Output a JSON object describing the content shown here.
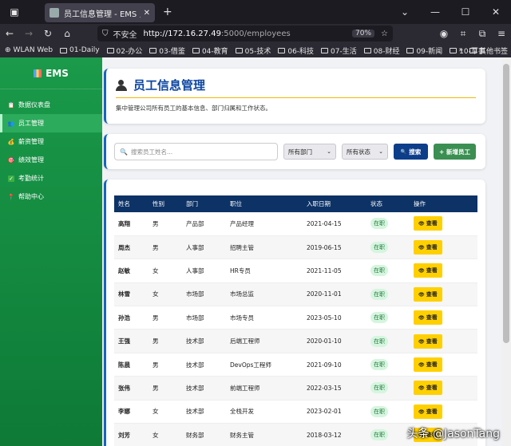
{
  "browser": {
    "tab_title": "员工信息管理 - EMS 员工管理",
    "url_insecure": "不安全",
    "url_host": "http://172.16.27.49",
    "url_path": ":5000/employees",
    "zoom": "70%",
    "bookmarks": [
      "WLAN Web",
      "01-Daily",
      "02-办公",
      "03-借鉴",
      "04-教育",
      "05-技术",
      "06-科技",
      "07-生活",
      "08-财经",
      "09-新闻",
      "10-军事"
    ],
    "bookmarks_other": "其他书签"
  },
  "sidebar": {
    "brand": "EMS",
    "items": [
      {
        "label": "数据仪表盘",
        "icon": "clipboard-icon"
      },
      {
        "label": "员工管理",
        "icon": "people-icon"
      },
      {
        "label": "薪资管理",
        "icon": "money-bag-icon"
      },
      {
        "label": "绩效管理",
        "icon": "target-icon"
      },
      {
        "label": "考勤统计",
        "icon": "check-icon"
      },
      {
        "label": "帮助中心",
        "icon": "pin-icon"
      }
    ]
  },
  "header": {
    "title": "员工信息管理",
    "description": "集中管理公司所有员工的基本信息、部门归属和工作状态。"
  },
  "filters": {
    "search_placeholder": "搜索员工姓名...",
    "department": "所有部门",
    "status": "所有状态",
    "search_button": "搜索",
    "add_button": "+ 新增员工"
  },
  "table": {
    "columns": [
      "姓名",
      "性别",
      "部门",
      "职位",
      "入职日期",
      "状态",
      "操作"
    ],
    "view_label": "查看",
    "rows": [
      {
        "name": "高翔",
        "gender": "男",
        "dept": "产品部",
        "position": "产品经理",
        "date": "2021-04-15",
        "status": "在职"
      },
      {
        "name": "周杰",
        "gender": "男",
        "dept": "人事部",
        "position": "招聘主管",
        "date": "2019-06-15",
        "status": "在职"
      },
      {
        "name": "赵敏",
        "gender": "女",
        "dept": "人事部",
        "position": "HR专员",
        "date": "2021-11-05",
        "status": "在职"
      },
      {
        "name": "林雪",
        "gender": "女",
        "dept": "市场部",
        "position": "市场总监",
        "date": "2020-11-01",
        "status": "在职"
      },
      {
        "name": "孙浩",
        "gender": "男",
        "dept": "市场部",
        "position": "市场专员",
        "date": "2023-05-10",
        "status": "在职"
      },
      {
        "name": "王强",
        "gender": "男",
        "dept": "技术部",
        "position": "后端工程师",
        "date": "2020-01-10",
        "status": "在职"
      },
      {
        "name": "陈晨",
        "gender": "男",
        "dept": "技术部",
        "position": "DevOps工程师",
        "date": "2021-09-10",
        "status": "在职"
      },
      {
        "name": "张伟",
        "gender": "男",
        "dept": "技术部",
        "position": "前端工程师",
        "date": "2022-03-15",
        "status": "在职"
      },
      {
        "name": "李娜",
        "gender": "女",
        "dept": "技术部",
        "position": "全栈开发",
        "date": "2023-02-01",
        "status": "在职"
      },
      {
        "name": "刘芳",
        "gender": "女",
        "dept": "财务部",
        "position": "财务主管",
        "date": "2018-03-12",
        "status": "在职"
      }
    ]
  },
  "watermark": "头条 @JasonTang"
}
